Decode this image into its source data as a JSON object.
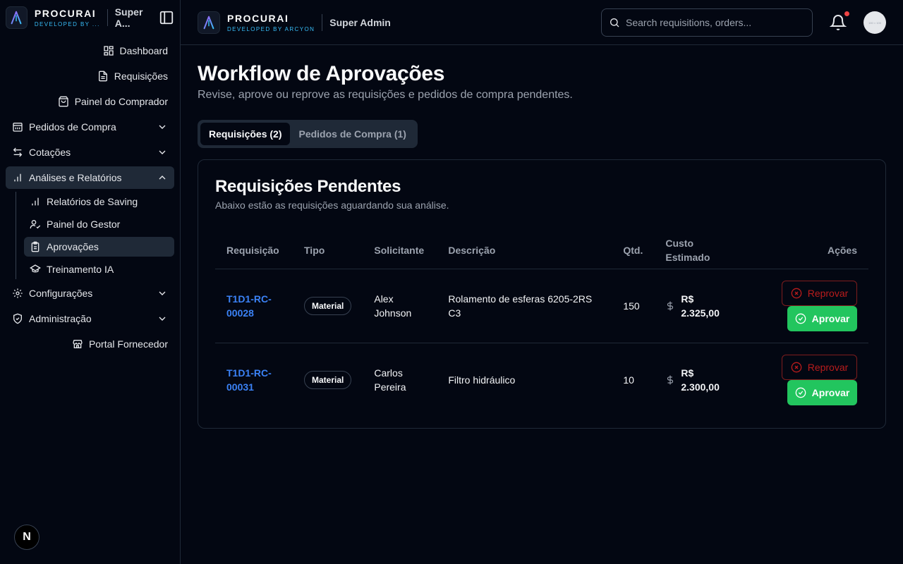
{
  "brand": {
    "name": "PROCURAI",
    "sub_sidebar": "DEVELOPED BY ...",
    "sub_header": "DEVELOPED BY ARCYON",
    "role_sidebar": "Super A...",
    "role_header": "Super Admin"
  },
  "sidebar": {
    "items": [
      {
        "label": "Dashboard",
        "icon": "dashboard-icon"
      },
      {
        "label": "Requisições",
        "icon": "file-icon"
      },
      {
        "label": "Painel do Comprador",
        "icon": "shopping-bag-icon"
      },
      {
        "label": "Pedidos de Compra",
        "icon": "calendar-icon"
      },
      {
        "label": "Cotações",
        "icon": "arrows-icon"
      },
      {
        "label": "Análises e Relatórios",
        "icon": "bar-chart-icon"
      },
      {
        "label": "Configurações",
        "icon": "gear-icon"
      },
      {
        "label": "Administração",
        "icon": "shield-icon"
      },
      {
        "label": "Portal Fornecedor",
        "icon": "store-icon"
      }
    ],
    "sub_items": [
      {
        "label": "Relatórios de Saving"
      },
      {
        "label": "Painel do Gestor"
      },
      {
        "label": "Aprovações"
      },
      {
        "label": "Treinamento IA"
      }
    ]
  },
  "header": {
    "search_placeholder": "Search requisitions, orders...",
    "avatar_text": "100 × 100"
  },
  "main": {
    "title": "Workflow de Aprovações",
    "subtitle": "Revise, aprove ou reprove as requisições e pedidos de compra pendentes.",
    "tabs": [
      {
        "label": "Requisições (2)"
      },
      {
        "label": "Pedidos de Compra (1)"
      }
    ],
    "card": {
      "title": "Requisições Pendentes",
      "subtitle": "Abaixo estão as requisições aguardando sua análise.",
      "columns": [
        "Requisição",
        "Tipo",
        "Solicitante",
        "Descrição",
        "Qtd.",
        "Custo Estimado",
        "Ações"
      ],
      "rows": [
        {
          "id": "T1D1-RC-00028",
          "type": "Material",
          "requester": "Alex Johnson",
          "description": "Rolamento de esferas 6205-2RS C3",
          "qty": "150",
          "cost": "R$ 2.325,00"
        },
        {
          "id": "T1D1-RC-00031",
          "type": "Material",
          "requester": "Carlos Pereira",
          "description": "Filtro hidráulico",
          "qty": "10",
          "cost": "R$ 2.300,00"
        }
      ],
      "reject_label": "Reprovar",
      "approve_label": "Aprovar"
    }
  },
  "colors": {
    "accent_link": "#3b82f6",
    "approve": "#22c55e",
    "reject": "#b91c1c",
    "notification": "#ef4444"
  }
}
